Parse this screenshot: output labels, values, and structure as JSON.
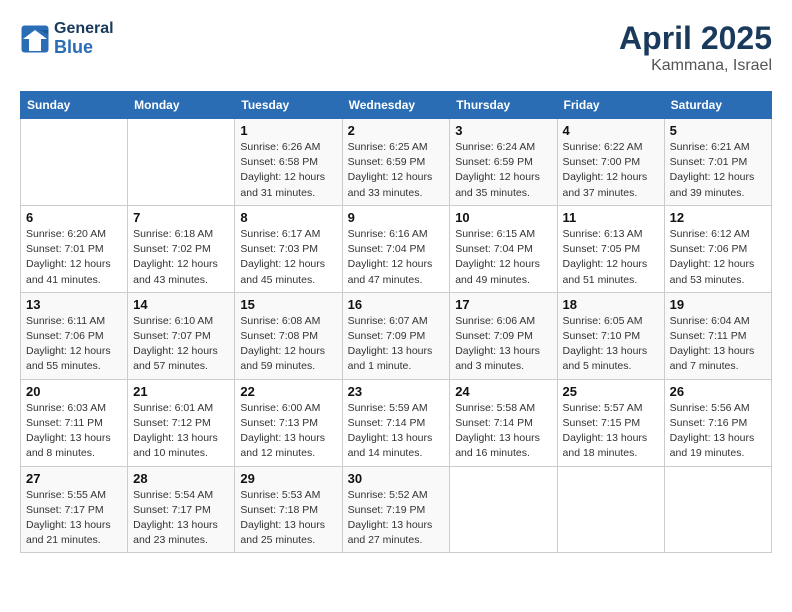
{
  "header": {
    "logo_general": "General",
    "logo_blue": "Blue",
    "month": "April 2025",
    "location": "Kammana, Israel"
  },
  "days_of_week": [
    "Sunday",
    "Monday",
    "Tuesday",
    "Wednesday",
    "Thursday",
    "Friday",
    "Saturday"
  ],
  "weeks": [
    [
      {
        "day": "",
        "detail": ""
      },
      {
        "day": "",
        "detail": ""
      },
      {
        "day": "1",
        "detail": "Sunrise: 6:26 AM\nSunset: 6:58 PM\nDaylight: 12 hours\nand 31 minutes."
      },
      {
        "day": "2",
        "detail": "Sunrise: 6:25 AM\nSunset: 6:59 PM\nDaylight: 12 hours\nand 33 minutes."
      },
      {
        "day": "3",
        "detail": "Sunrise: 6:24 AM\nSunset: 6:59 PM\nDaylight: 12 hours\nand 35 minutes."
      },
      {
        "day": "4",
        "detail": "Sunrise: 6:22 AM\nSunset: 7:00 PM\nDaylight: 12 hours\nand 37 minutes."
      },
      {
        "day": "5",
        "detail": "Sunrise: 6:21 AM\nSunset: 7:01 PM\nDaylight: 12 hours\nand 39 minutes."
      }
    ],
    [
      {
        "day": "6",
        "detail": "Sunrise: 6:20 AM\nSunset: 7:01 PM\nDaylight: 12 hours\nand 41 minutes."
      },
      {
        "day": "7",
        "detail": "Sunrise: 6:18 AM\nSunset: 7:02 PM\nDaylight: 12 hours\nand 43 minutes."
      },
      {
        "day": "8",
        "detail": "Sunrise: 6:17 AM\nSunset: 7:03 PM\nDaylight: 12 hours\nand 45 minutes."
      },
      {
        "day": "9",
        "detail": "Sunrise: 6:16 AM\nSunset: 7:04 PM\nDaylight: 12 hours\nand 47 minutes."
      },
      {
        "day": "10",
        "detail": "Sunrise: 6:15 AM\nSunset: 7:04 PM\nDaylight: 12 hours\nand 49 minutes."
      },
      {
        "day": "11",
        "detail": "Sunrise: 6:13 AM\nSunset: 7:05 PM\nDaylight: 12 hours\nand 51 minutes."
      },
      {
        "day": "12",
        "detail": "Sunrise: 6:12 AM\nSunset: 7:06 PM\nDaylight: 12 hours\nand 53 minutes."
      }
    ],
    [
      {
        "day": "13",
        "detail": "Sunrise: 6:11 AM\nSunset: 7:06 PM\nDaylight: 12 hours\nand 55 minutes."
      },
      {
        "day": "14",
        "detail": "Sunrise: 6:10 AM\nSunset: 7:07 PM\nDaylight: 12 hours\nand 57 minutes."
      },
      {
        "day": "15",
        "detail": "Sunrise: 6:08 AM\nSunset: 7:08 PM\nDaylight: 12 hours\nand 59 minutes."
      },
      {
        "day": "16",
        "detail": "Sunrise: 6:07 AM\nSunset: 7:09 PM\nDaylight: 13 hours\nand 1 minute."
      },
      {
        "day": "17",
        "detail": "Sunrise: 6:06 AM\nSunset: 7:09 PM\nDaylight: 13 hours\nand 3 minutes."
      },
      {
        "day": "18",
        "detail": "Sunrise: 6:05 AM\nSunset: 7:10 PM\nDaylight: 13 hours\nand 5 minutes."
      },
      {
        "day": "19",
        "detail": "Sunrise: 6:04 AM\nSunset: 7:11 PM\nDaylight: 13 hours\nand 7 minutes."
      }
    ],
    [
      {
        "day": "20",
        "detail": "Sunrise: 6:03 AM\nSunset: 7:11 PM\nDaylight: 13 hours\nand 8 minutes."
      },
      {
        "day": "21",
        "detail": "Sunrise: 6:01 AM\nSunset: 7:12 PM\nDaylight: 13 hours\nand 10 minutes."
      },
      {
        "day": "22",
        "detail": "Sunrise: 6:00 AM\nSunset: 7:13 PM\nDaylight: 13 hours\nand 12 minutes."
      },
      {
        "day": "23",
        "detail": "Sunrise: 5:59 AM\nSunset: 7:14 PM\nDaylight: 13 hours\nand 14 minutes."
      },
      {
        "day": "24",
        "detail": "Sunrise: 5:58 AM\nSunset: 7:14 PM\nDaylight: 13 hours\nand 16 minutes."
      },
      {
        "day": "25",
        "detail": "Sunrise: 5:57 AM\nSunset: 7:15 PM\nDaylight: 13 hours\nand 18 minutes."
      },
      {
        "day": "26",
        "detail": "Sunrise: 5:56 AM\nSunset: 7:16 PM\nDaylight: 13 hours\nand 19 minutes."
      }
    ],
    [
      {
        "day": "27",
        "detail": "Sunrise: 5:55 AM\nSunset: 7:17 PM\nDaylight: 13 hours\nand 21 minutes."
      },
      {
        "day": "28",
        "detail": "Sunrise: 5:54 AM\nSunset: 7:17 PM\nDaylight: 13 hours\nand 23 minutes."
      },
      {
        "day": "29",
        "detail": "Sunrise: 5:53 AM\nSunset: 7:18 PM\nDaylight: 13 hours\nand 25 minutes."
      },
      {
        "day": "30",
        "detail": "Sunrise: 5:52 AM\nSunset: 7:19 PM\nDaylight: 13 hours\nand 27 minutes."
      },
      {
        "day": "",
        "detail": ""
      },
      {
        "day": "",
        "detail": ""
      },
      {
        "day": "",
        "detail": ""
      }
    ]
  ]
}
